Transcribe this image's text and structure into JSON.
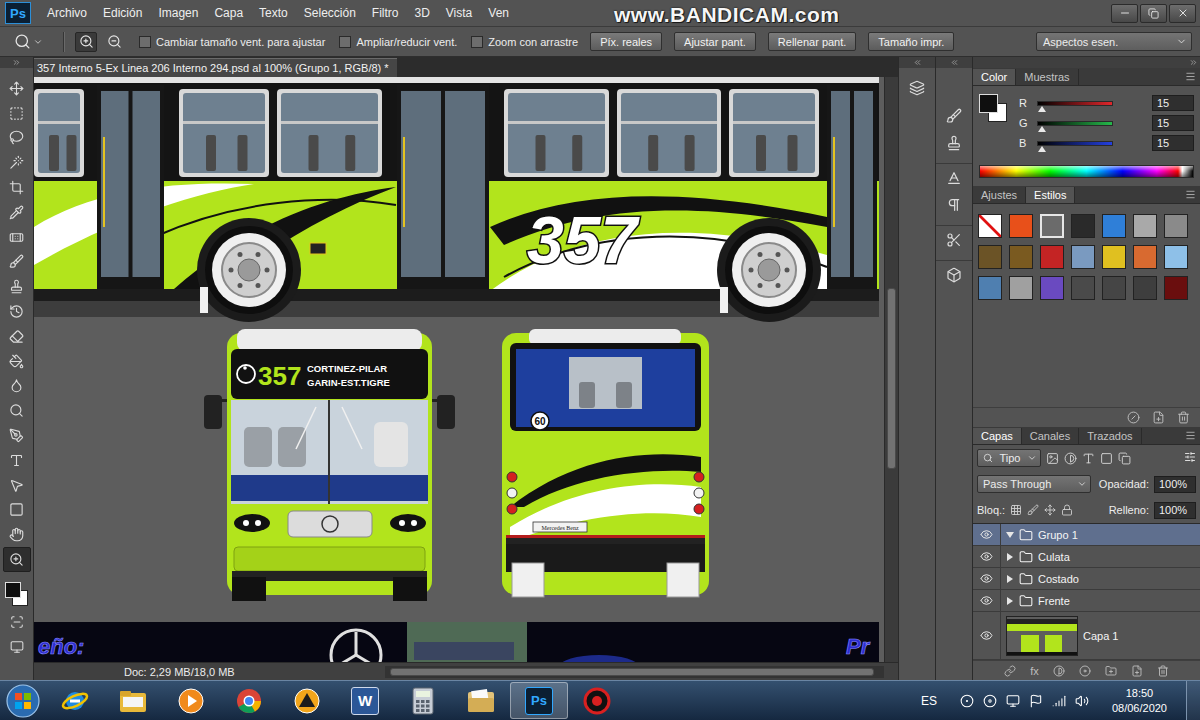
{
  "app": {
    "logo": "Ps",
    "watermark": "www.BANDICAM.com"
  },
  "menu": [
    "Archivo",
    "Edición",
    "Imagen",
    "Capa",
    "Texto",
    "Selección",
    "Filtro",
    "3D",
    "Vista",
    "Ven"
  ],
  "options_bar": {
    "zoom_in_pressed": true,
    "checkboxes": [
      {
        "label": "Cambiar tamaño vent. para ajustar",
        "checked": false
      },
      {
        "label": "Ampliar/reducir vent.",
        "checked": false
      },
      {
        "label": "Zoom con arrastre",
        "checked": false
      }
    ],
    "buttons": [
      "Píx. reales",
      "Ajustar pant.",
      "Rellenar pant.",
      "Tamaño impr."
    ],
    "workspace": "Aspectos esen."
  },
  "tools": [
    {
      "kind": "move",
      "selected": false
    },
    {
      "kind": "marquee",
      "selected": false
    },
    {
      "kind": "lasso",
      "selected": false
    },
    {
      "kind": "quick-select",
      "selected": false
    },
    {
      "kind": "crop",
      "selected": false
    },
    {
      "kind": "eyedropper",
      "selected": false
    },
    {
      "kind": "healing",
      "selected": false
    },
    {
      "kind": "brush",
      "selected": false
    },
    {
      "kind": "stamp",
      "selected": false
    },
    {
      "kind": "history-brush",
      "selected": false
    },
    {
      "kind": "eraser",
      "selected": false
    },
    {
      "kind": "bucket",
      "selected": false
    },
    {
      "kind": "blur",
      "selected": false
    },
    {
      "kind": "dodge",
      "selected": false
    },
    {
      "kind": "pen",
      "selected": false
    },
    {
      "kind": "type",
      "selected": false
    },
    {
      "kind": "path-select",
      "selected": false
    },
    {
      "kind": "shape",
      "selected": false
    },
    {
      "kind": "hand",
      "selected": false
    },
    {
      "kind": "zoom",
      "selected": true
    }
  ],
  "document": {
    "title": "357 Interno 5-Ex Linea 206 Interno 294.psd al 100% (Grupo 1, RGB/8) *",
    "status": "Doc: 2,29 MB/18,0 MB",
    "scrollbars": {
      "vertical": {
        "start": 0.36,
        "size": 0.31
      },
      "horizontal": {
        "start": 0.01,
        "size": 0.97
      }
    },
    "canvas": {
      "side_number": "357",
      "sign_number": "357",
      "sign_lines": [
        "CORTINEZ-PILAR",
        "GARIN-EST.TIGRE"
      ],
      "rear_badge": "60",
      "rear_plate": "Mercedes Benz",
      "footer_left": "eño:",
      "footer_right": "Pr"
    }
  },
  "color_panel": {
    "tabs": [
      {
        "label": "Color",
        "selected": true
      },
      {
        "label": "Muestras",
        "selected": false
      }
    ],
    "channels": [
      {
        "label": "R",
        "value": "15",
        "level": 0.06,
        "color": "#e0262b"
      },
      {
        "label": "G",
        "value": "15",
        "level": 0.06,
        "color": "#25b84a"
      },
      {
        "label": "B",
        "value": "15",
        "level": 0.06,
        "color": "#2440e0"
      }
    ]
  },
  "styles_panel": {
    "tabs": [
      {
        "label": "Ajustes",
        "selected": false
      },
      {
        "label": "Estilos",
        "selected": true
      }
    ],
    "swatches": [
      {
        "kind": "none",
        "color": "#ffffff",
        "selected": false
      },
      {
        "kind": "fill",
        "color": "#e8501a",
        "selected": false
      },
      {
        "kind": "fill",
        "color": "#6b6b6b",
        "selected": true
      },
      {
        "kind": "fill",
        "color": "#2a2a2a",
        "selected": false
      },
      {
        "kind": "fill",
        "color": "#2f7fd8",
        "selected": false
      },
      {
        "kind": "fill",
        "color": "#a9a9a9",
        "selected": false
      },
      {
        "kind": "fill",
        "color": "#8a8a8a",
        "selected": false
      },
      {
        "kind": "fill",
        "color": "#6b5326",
        "selected": false
      },
      {
        "kind": "fill",
        "color": "#7a5a20",
        "selected": false
      },
      {
        "kind": "fill",
        "color": "#c42424",
        "selected": false
      },
      {
        "kind": "fill",
        "color": "#7a9ac0",
        "selected": false
      },
      {
        "kind": "fill",
        "color": "#e0c020",
        "selected": false
      },
      {
        "kind": "fill",
        "color": "#d86a30",
        "selected": false
      },
      {
        "kind": "fill",
        "color": "#8ec0e8",
        "selected": false
      },
      {
        "kind": "fill",
        "color": "#4f7fb0",
        "selected": false
      },
      {
        "kind": "fill",
        "color": "#a0a0a0",
        "selected": false
      },
      {
        "kind": "fill",
        "color": "#6a4ac0",
        "selected": false
      },
      {
        "kind": "fill",
        "color": "#4a4a4a",
        "selected": false
      },
      {
        "kind": "fill",
        "color": "#454545",
        "selected": false
      },
      {
        "kind": "fill",
        "color": "#3e3e3e",
        "selected": false
      },
      {
        "kind": "fill",
        "color": "#6a0e0e",
        "selected": false
      }
    ]
  },
  "layers_panel": {
    "tabs": [
      {
        "label": "Capas",
        "selected": true
      },
      {
        "label": "Canales",
        "selected": false
      },
      {
        "label": "Trazados",
        "selected": false
      }
    ],
    "filter": "Tipo",
    "blend": "Pass Through",
    "opacity": {
      "label": "Opacidad:",
      "value": "100%"
    },
    "lock_label": "Bloq.:",
    "fill": {
      "label": "Relleno:",
      "value": "100%"
    },
    "layers": [
      {
        "name": "Grupo 1",
        "kind": "group",
        "visible": true,
        "expanded": true,
        "selected": true
      },
      {
        "name": "Culata",
        "kind": "group",
        "visible": true,
        "expanded": false,
        "selected": false
      },
      {
        "name": "Costado",
        "kind": "group",
        "visible": true,
        "expanded": false,
        "selected": false
      },
      {
        "name": "Frente",
        "kind": "group",
        "visible": true,
        "expanded": false,
        "selected": false
      },
      {
        "name": "Capa 1",
        "kind": "layer",
        "visible": true,
        "expanded": false,
        "selected": false
      }
    ],
    "footer_label": "fx"
  },
  "taskbar": {
    "apps": [
      {
        "kind": "ie",
        "label": "",
        "selected": false
      },
      {
        "kind": "explorer",
        "label": "",
        "selected": false
      },
      {
        "kind": "media",
        "label": "",
        "selected": false
      },
      {
        "kind": "chrome",
        "label": "",
        "selected": false
      },
      {
        "kind": "avast",
        "label": "",
        "selected": false
      },
      {
        "kind": "word",
        "label": "W",
        "selected": false
      },
      {
        "kind": "calculator",
        "label": "",
        "selected": false
      },
      {
        "kind": "folder",
        "label": "",
        "selected": false
      },
      {
        "kind": "photoshop",
        "label": "Ps",
        "selected": true
      },
      {
        "kind": "bandicam",
        "label": "",
        "selected": false
      }
    ],
    "language": "ES",
    "time": "18:50",
    "date": "08/06/2020"
  }
}
